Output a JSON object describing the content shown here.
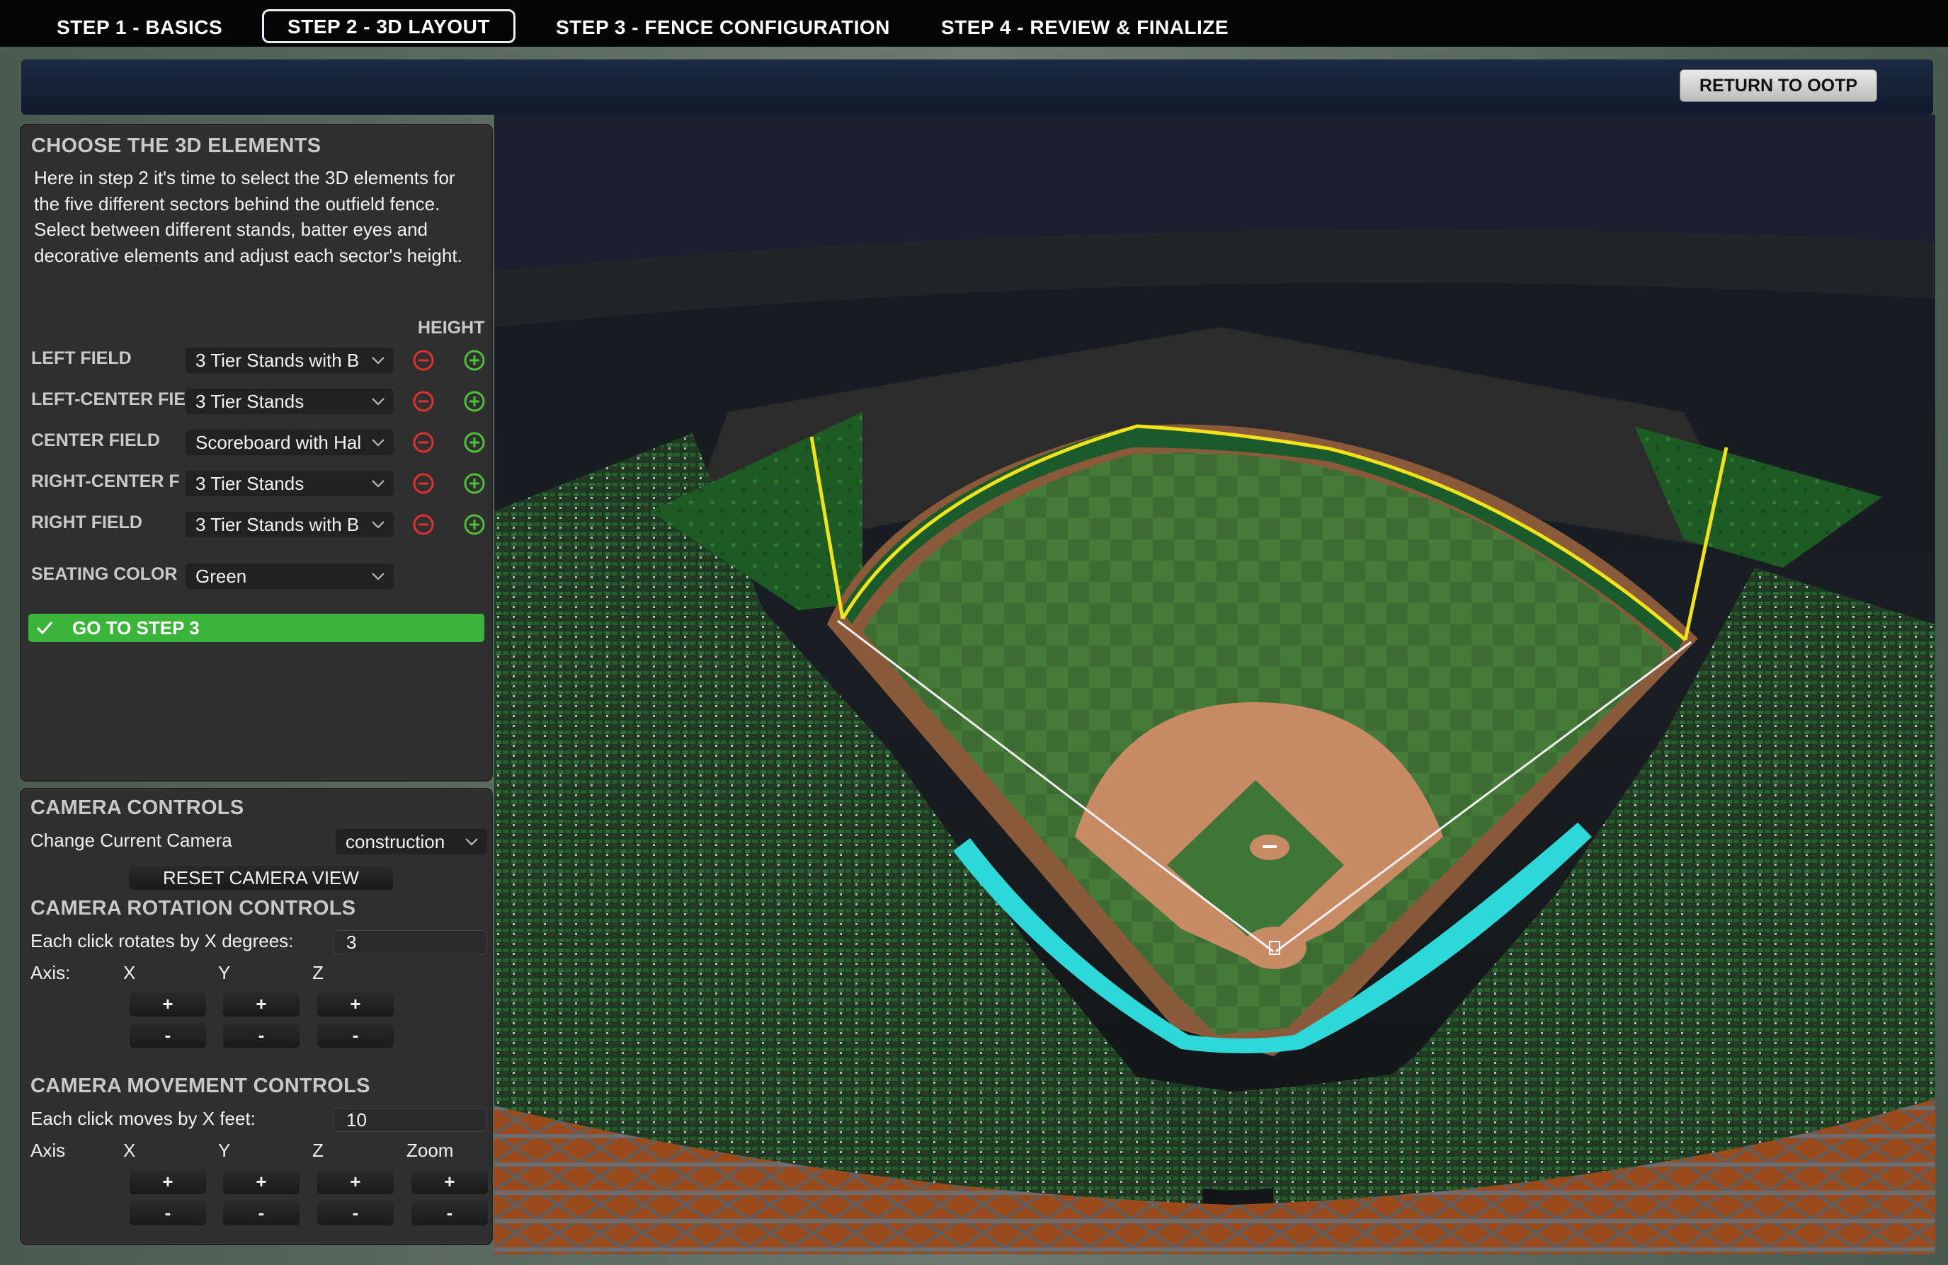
{
  "tabs": [
    {
      "label": "STEP 1 - BASICS",
      "active": false
    },
    {
      "label": "STEP 2 - 3D LAYOUT",
      "active": true
    },
    {
      "label": "STEP 3 - FENCE CONFIGURATION",
      "active": false
    },
    {
      "label": "STEP 4 - REVIEW & FINALIZE",
      "active": false
    }
  ],
  "return_button": "RETURN TO OOTP",
  "elements_panel": {
    "title": "CHOOSE THE 3D ELEMENTS",
    "intro": "Here in step 2 it's time to select the 3D elements for the five different sectors behind the outfield fence. Select between different stands, batter eyes and decorative elements and adjust each sector's height.",
    "height_header": "HEIGHT",
    "sectors": [
      {
        "label": "LEFT FIELD",
        "value": "3 Tier Stands with B"
      },
      {
        "label": "LEFT-CENTER FIE",
        "value": "3 Tier Stands"
      },
      {
        "label": "CENTER FIELD",
        "value": "Scoreboard with Hal"
      },
      {
        "label": "RIGHT-CENTER F",
        "value": "3 Tier Stands"
      },
      {
        "label": "RIGHT FIELD",
        "value": "3 Tier Stands with B"
      }
    ],
    "seating_label": "SEATING COLOR",
    "seating_value": "Green",
    "go_button": "GO TO STEP 3"
  },
  "camera_panel": {
    "title": "CAMERA CONTROLS",
    "change_camera_label": "Change Current Camera",
    "camera_value": "construction",
    "reset_button": "RESET CAMERA VIEW",
    "rotation_title": "CAMERA ROTATION CONTROLS",
    "rotation_step_label": "Each click rotates by X degrees:",
    "rotation_step_value": "3",
    "rotation_axis_label": "Axis:",
    "rotation_axes": [
      "X",
      "Y",
      "Z"
    ],
    "movement_title": "CAMERA MOVEMENT CONTROLS",
    "movement_step_label": "Each click moves by X feet:",
    "movement_step_value": "10",
    "movement_axis_label": "Axis",
    "movement_axes": [
      "X",
      "Y",
      "Z",
      "Zoom"
    ],
    "plus": "+",
    "minus": "-"
  },
  "colors": {
    "accent_green": "#3bb43a",
    "minus_red": "#e03030",
    "plus_green": "#4fbf3a",
    "fence_yellow": "#f2e21a",
    "wall_cyan": "#2fd8d8",
    "nav_blue": "#16213a"
  }
}
